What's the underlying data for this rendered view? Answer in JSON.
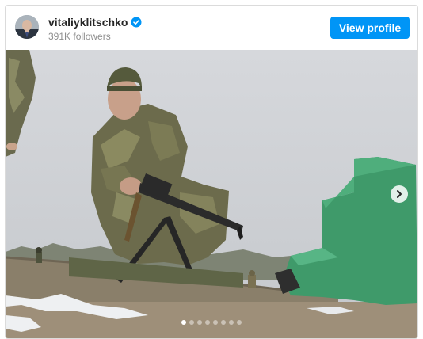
{
  "header": {
    "username": "vitaliyklitschko",
    "followers": "391K followers",
    "view_profile_label": "View profile",
    "verified_icon": "verified-badge-icon"
  },
  "carousel": {
    "slide_count": 8,
    "active_index": 0,
    "next_icon": "chevron-right-icon"
  },
  "colors": {
    "accent": "#0095f6",
    "verified": "#0095f6"
  }
}
